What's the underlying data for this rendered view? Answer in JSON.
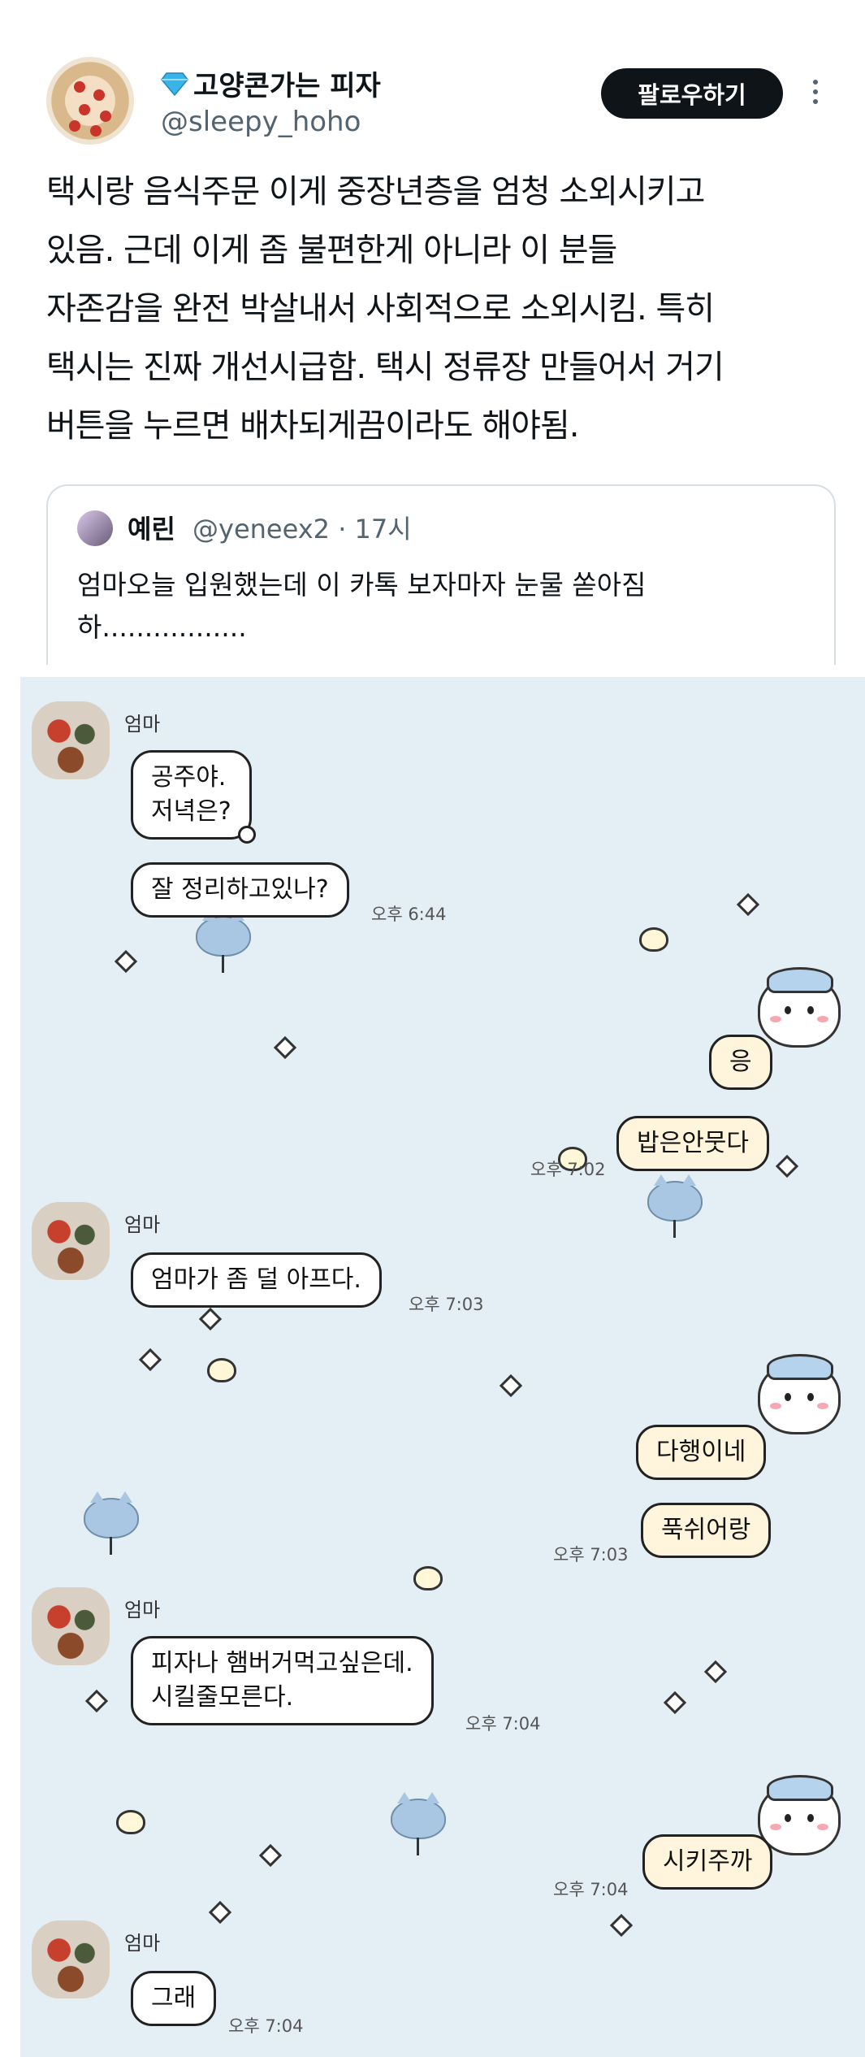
{
  "tweet": {
    "display_name": "고양콘가는 피자",
    "handle": "@sleepy_hoho",
    "follow_label": "팔로우하기",
    "lines": [
      "택시랑 음식주문 이게 중장년층을 엄청 소외시키고",
      "있음. 근데 이게 좀 불편한게 아니라 이 분들",
      "자존감을 완전 박살내서 사회적으로 소외시킴. 특히",
      "택시는 진짜 개선시급함. 택시 정류장 만들어서 거기",
      "버튼을 누르면 배차되게끔이라도 해야됨."
    ]
  },
  "quote": {
    "name": "예린",
    "meta": "@yeneex2 · 17시",
    "lines": [
      "엄마오늘 입원했는데 이 카톡 보자마자 눈물 쏟아짐",
      "하................."
    ]
  },
  "chat": {
    "sender": "엄마",
    "mom_block_1": {
      "bubble_1": [
        "공주야.",
        "저녁은?"
      ],
      "bubble_2": "잘 정리하고있나?",
      "time": "오후 6:44"
    },
    "me_block_1": {
      "bubble_1": "응",
      "bubble_2": "밥은안뭇다",
      "time": "오후 7:02"
    },
    "mom_block_2": {
      "bubble_1": "엄마가 좀 덜 아프다.",
      "time": "오후 7:03"
    },
    "me_block_2": {
      "bubble_1": "다행이네",
      "bubble_2": "푹쉬어랑",
      "time": "오후 7:03"
    },
    "mom_block_3": {
      "bubble_1": [
        "피자나 햄버거먹고싶은데.",
        "시킬줄모른다."
      ],
      "time": "오후 7:04"
    },
    "me_block_3": {
      "bubble_1": "시키주까",
      "time": "오후 7:04"
    },
    "mom_block_4": {
      "bubble_1": "그래",
      "time": "오후 7:04"
    }
  },
  "colors": {
    "chat_background": "#e4eef5",
    "my_bubble": "#fff4dc",
    "follow_button": "#0f1419"
  },
  "icons": [
    "diamond-icon",
    "more-icon",
    "sparkle-icon",
    "heart-icon",
    "cat-sticker-icon",
    "chiikawa-sticker-icon"
  ]
}
